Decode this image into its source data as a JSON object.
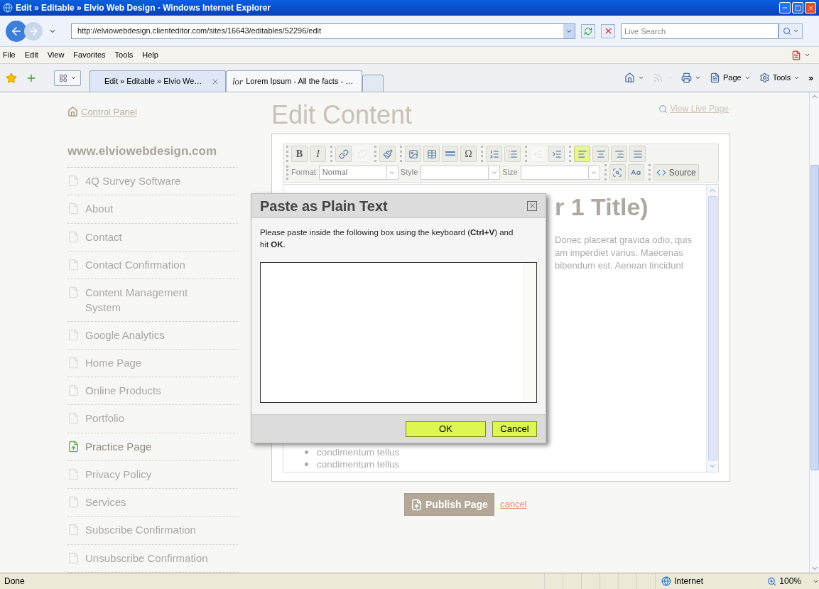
{
  "window": {
    "title": "Edit » Editable » Elvio Web Design - Windows Internet Explorer"
  },
  "address_bar": {
    "url": "http://elviowebdesign.clienteditor.com/sites/16643/editables/52296/edit",
    "search_placeholder": "Live Search"
  },
  "menu": [
    "File",
    "Edit",
    "View",
    "Favorites",
    "Tools",
    "Help"
  ],
  "tabs": [
    {
      "label": "Edit » Editable » Elvio We…",
      "selected": true
    },
    {
      "label": "Lorem Ipsum - All the facts - …",
      "favicon_text": "lor",
      "selected": false
    }
  ],
  "command_bar": [
    {
      "kind": "home",
      "disabled": false
    },
    {
      "kind": "feeds",
      "disabled": true
    },
    {
      "kind": "print",
      "disabled": false
    },
    {
      "kind": "page",
      "label": "Page",
      "disabled": false
    },
    {
      "kind": "tools",
      "label": "Tools",
      "disabled": false
    }
  ],
  "command_bar_more": "»",
  "sidebar": {
    "control_panel": "Control Panel",
    "site": "www.elviowebdesign.com",
    "pages": [
      {
        "label": "4Q Survey Software",
        "selected": false
      },
      {
        "label": "About",
        "selected": false
      },
      {
        "label": "Contact",
        "selected": false
      },
      {
        "label": "Contact Confirmation",
        "selected": false
      },
      {
        "label": "Content Management System",
        "selected": false
      },
      {
        "label": "Google Analytics",
        "selected": false
      },
      {
        "label": "Home Page",
        "selected": false
      },
      {
        "label": "Online Products",
        "selected": false
      },
      {
        "label": "Portfolio",
        "selected": false
      },
      {
        "label": "Practice Page",
        "selected": true
      },
      {
        "label": "Privacy Policy",
        "selected": false
      },
      {
        "label": "Services",
        "selected": false
      },
      {
        "label": "Subscribe Confirmation",
        "selected": false
      },
      {
        "label": "Unsubscribe Confirmation",
        "selected": false
      }
    ]
  },
  "main": {
    "title": "Edit Content",
    "view_live": "View Live Page"
  },
  "editor": {
    "toolbar": [
      [
        [
          {
            "kind": "bold",
            "label": "B",
            "disabled": false,
            "selected": false
          },
          {
            "kind": "italic",
            "label": "I",
            "disabled": false,
            "selected": false
          }
        ],
        [
          {
            "kind": "link",
            "disabled": false,
            "selected": false
          },
          {
            "kind": "unlink",
            "disabled": true,
            "selected": false
          }
        ],
        [
          {
            "kind": "paste",
            "disabled": false,
            "selected": false
          }
        ],
        [
          {
            "kind": "image",
            "disabled": false,
            "selected": false
          },
          {
            "kind": "table",
            "disabled": false,
            "selected": false
          },
          {
            "kind": "rule",
            "disabled": false,
            "selected": false
          },
          {
            "kind": "char",
            "label": "Ω",
            "disabled": false,
            "selected": false
          }
        ],
        [
          {
            "kind": "ol",
            "disabled": false,
            "selected": false
          },
          {
            "kind": "ul",
            "disabled": false,
            "selected": false
          }
        ],
        [
          {
            "kind": "outdent",
            "disabled": true,
            "selected": false
          },
          {
            "kind": "indent",
            "disabled": false,
            "selected": false
          }
        ],
        [
          {
            "kind": "left",
            "disabled": false,
            "selected": true
          },
          {
            "kind": "center",
            "disabled": false,
            "selected": false
          },
          {
            "kind": "right",
            "disabled": false,
            "selected": false
          },
          {
            "kind": "justify",
            "disabled": false,
            "selected": false
          }
        ]
      ],
      [
        [
          {
            "kind": "select",
            "label": "Format",
            "value": "Normal"
          },
          {
            "kind": "select",
            "label": "Style"
          },
          {
            "kind": "select",
            "label": "Size"
          }
        ],
        [
          {
            "kind": "preview",
            "disabled": false,
            "selected": false
          },
          {
            "kind": "spellcheck",
            "disabled": false,
            "selected": false
          }
        ],
        [
          {
            "kind": "source",
            "label": "Source",
            "disabled": false,
            "selected": false
          }
        ]
      ]
    ],
    "content": {
      "heading": "r 1 Title)",
      "lines": [
        "Donec placerat gravida odio, quis",
        "am imperdiet varius. Maecenas",
        "bibendum est. Aenean tincidunt"
      ],
      "bullets": [
        "condimentum tellus",
        "condimentum tellus"
      ]
    }
  },
  "dialog": {
    "title": "Paste as Plain Text",
    "instructions": "Please paste inside the following box using the keyboard (**Ctrl+V**) and hit **OK**.",
    "buttons": [
      "OK",
      "Cancel"
    ]
  },
  "publish": {
    "button": "Publish Page",
    "cancel": "cancel"
  },
  "status_bar": {
    "text": "Done",
    "zone": "Internet",
    "zoom": "100%"
  }
}
